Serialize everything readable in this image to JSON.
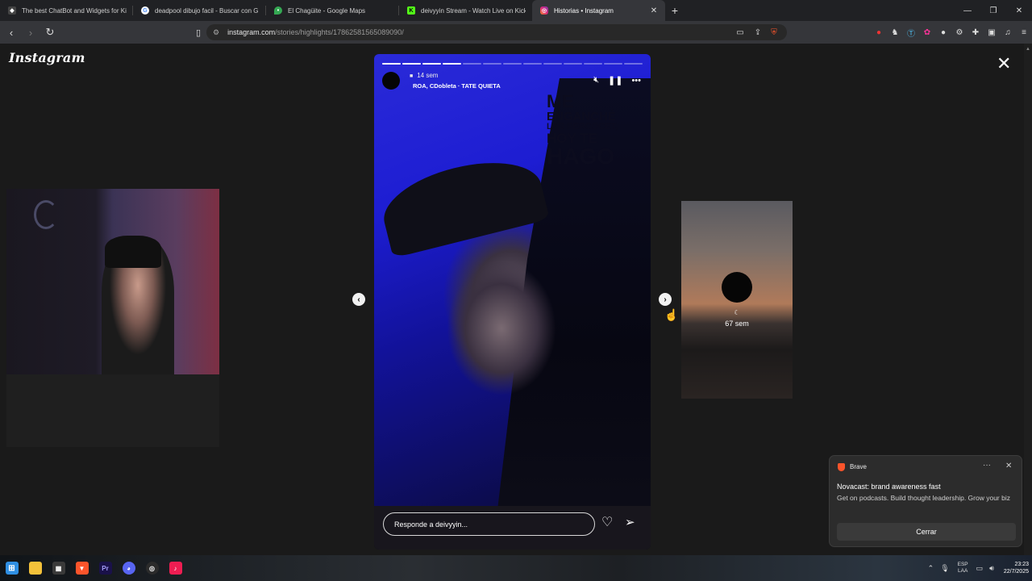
{
  "browser": {
    "tabs": [
      {
        "label": "The best ChatBot and Widgets for Ki",
        "icon": "kick-bot-icon",
        "color": "#444444",
        "active": false
      },
      {
        "label": "deadpool dibujo facil - Buscar con G",
        "icon": "google-icon",
        "color": "#4285f4",
        "active": false
      },
      {
        "label": "El Chagüite - Google Maps",
        "icon": "maps-pin-icon",
        "color": "#34a853",
        "active": false
      },
      {
        "label": "deivyyin Stream - Watch Live on Kick",
        "icon": "kick-icon",
        "color": "#53fc18",
        "active": false
      },
      {
        "label": "Historias • Instagram",
        "icon": "instagram-icon",
        "color": "#e1306c",
        "active": true
      }
    ],
    "new_tab_symbol": "+",
    "url_host": "instagram.com",
    "url_path": "/stories/highlights/17862581565089090/"
  },
  "instagram": {
    "logo": "Instagram",
    "story": {
      "segments_total": 13,
      "segments_done": 4,
      "time_ago": "14 sem",
      "music": "ROA, CDobleta · TATE QUIETA",
      "overlay_lines": [
        "ME",
        "ENGANCHÉ",
        "LAS PERCOCET,",
        "HOY TE",
        "HAGO"
      ],
      "reply_placeholder": "Responde a deivyyin..."
    },
    "next_preview": {
      "time_ago": "67 sem",
      "moon": "☾"
    }
  },
  "notification": {
    "app": "Brave",
    "title": "Novacast: brand awareness fast",
    "body": "Get on podcasts. Build thought leadership. Grow your biz",
    "button": "Cerrar",
    "accent": "#fb542b"
  },
  "taskbar": {
    "lang_line1": "ESP",
    "lang_line2": "LAA",
    "time": "23:23",
    "date": "22/7/2025"
  }
}
